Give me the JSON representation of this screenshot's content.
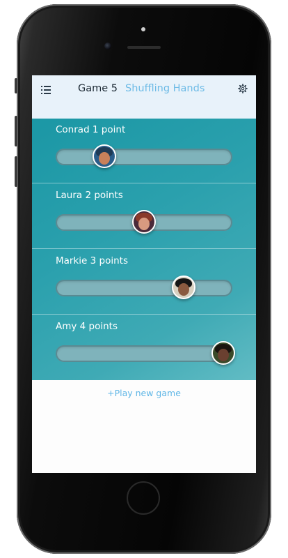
{
  "header": {
    "game_label": "Game 5",
    "mode_label": "Shuffling Hands",
    "menu_icon": "list-menu-icon",
    "settings_icon": "gear-icon"
  },
  "players": [
    {
      "label": "Conrad 1 point",
      "name": "Conrad",
      "points": 1,
      "slider_position": 0.25,
      "avatar_colors": {
        "bg": "#2b5d8a",
        "hair": "#1f3a55",
        "skin": "#c8805a"
      }
    },
    {
      "label": "Laura 2 points",
      "name": "Laura",
      "points": 2,
      "slider_position": 0.5,
      "avatar_colors": {
        "bg": "#4a2a3a",
        "hair": "#8a3a2a",
        "skin": "#d89a80"
      }
    },
    {
      "label": "Markie 3 points",
      "name": "Markie",
      "points": 3,
      "slider_position": 0.75,
      "avatar_colors": {
        "bg": "#d8d0c0",
        "hair": "#151515",
        "skin": "#8a5a40"
      }
    },
    {
      "label": "Amy 4 points",
      "name": "Amy",
      "points": 4,
      "slider_position": 1.0,
      "avatar_colors": {
        "bg": "#3a4a2a",
        "hair": "#1a1410",
        "skin": "#6a4030"
      }
    }
  ],
  "footer": {
    "new_game_label": "+Play new game"
  },
  "colors": {
    "accent": "#5fb6e6",
    "board_teal": "#2aa0ad",
    "header_bg": "#e8f2fa"
  }
}
